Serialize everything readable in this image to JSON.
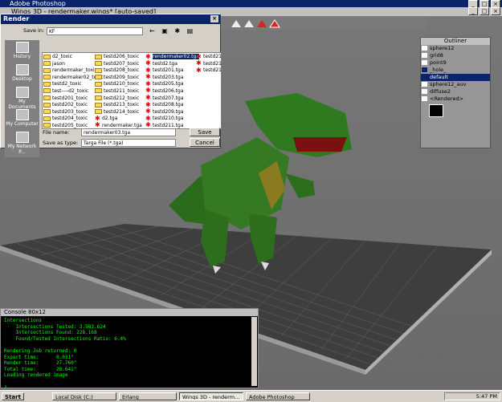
{
  "app_title": "Adobe Photoshop",
  "wings_title": "Wings 3D - rendermaker.wings* [auto-saved]",
  "render_dialog": {
    "title": "Render",
    "save_in_label": "Save in:",
    "save_in_value": "KF",
    "places": [
      "History",
      "Desktop",
      "My Documents",
      "My Computer",
      "My Network P..."
    ],
    "files": [
      [
        "d2_toxic",
        "jason",
        "rendermaker_toxic",
        "rendermaker02_toxic",
        "testd2_toxic",
        "test----d2_toxic",
        "testd201_toxic",
        "testd202_toxic",
        "testd203_toxic",
        "testd204_toxic",
        "testd205_toxic"
      ],
      [
        "testd206_toxic",
        "testd207_toxic",
        "testd208_toxic",
        "testd209_toxic",
        "testd210_toxic",
        "testd211_toxic",
        "testd212_toxic",
        "testd213_toxic",
        "testd214_toxic",
        "d2.tga",
        "rendermaker.tga"
      ],
      [
        "rendermaker02.tga",
        "testd2.tga",
        "testd201.tga",
        "testd203.tga",
        "testd205.tga",
        "testd206.tga",
        "testd207.tga",
        "testd208.tga",
        "testd209.tga",
        "testd210.tga",
        "testd211.tga"
      ],
      [
        "testd21",
        "testd21",
        "testd21"
      ]
    ],
    "selected_file": "rendermaker02.tga",
    "filename_label": "File name:",
    "filename_value": "rendermaker03.tga",
    "save_as_label": "Save as type:",
    "save_as_value": "Targa File (*.tga)",
    "save_button": "Save",
    "cancel_button": "Cancel"
  },
  "outliner": {
    "title": "Outliner",
    "items": [
      "sphere12",
      "grid8",
      "point9",
      "_hole_",
      "default",
      "sphere12_auv",
      "diffuse2",
      "<Rendered>"
    ],
    "selected": "default"
  },
  "console": {
    "title": "Console 80x12",
    "lines": [
      "Intersections",
      "    Intersections Tested: 3.583.624",
      "    Intersections Found: 228.168",
      "    Found/Tested Intersections Ratio: 6.4%",
      "",
      "Rendering Job returned: 0",
      "Export time:      0.031\"",
      "Render time:      27.760\"",
      "Total time:       28.641\"",
      "Loading rendered image",
      "",
      "?"
    ]
  },
  "taskbar": {
    "start": "Start",
    "tasks": [
      "Local Disk (C:)",
      "Erlang",
      "Wings 3D - renderm...",
      "Adobe Photoshop"
    ],
    "active_task": "Wings 3D - renderm...",
    "clock": "5:47 PM"
  }
}
